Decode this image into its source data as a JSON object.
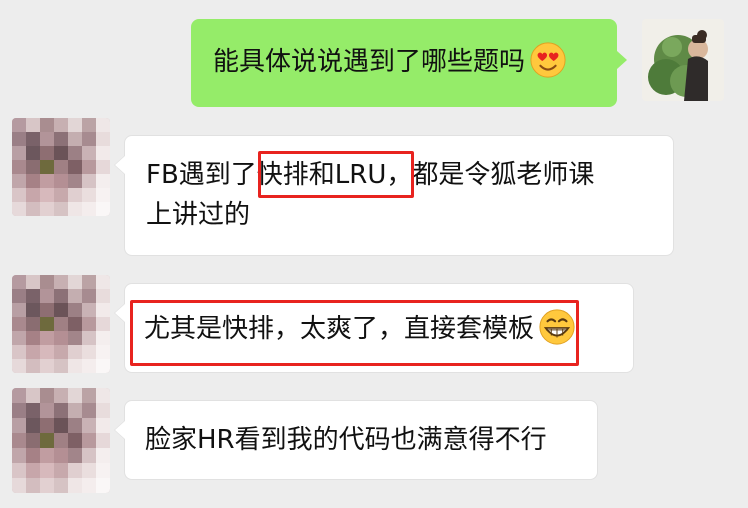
{
  "messages": [
    {
      "side": "outgoing",
      "text": "能具体说说遇到了哪些题吗",
      "emoji": "heart-eyes-emoji"
    },
    {
      "side": "incoming",
      "text_pre": "FB遇到了",
      "text_highlight": "快排和LRU",
      "text_after_line1": "，都是令狐老师课",
      "text_line2": "上讲过的"
    },
    {
      "side": "incoming",
      "text": "尤其是快排，太爽了，直接套模板",
      "emoji": "grinning-emoji"
    },
    {
      "side": "incoming",
      "text": "脸家HR看到我的代码也满意得不行"
    }
  ],
  "colors": {
    "background": "#ededed",
    "outgoing_bubble": "#95ec69",
    "incoming_bubble": "#ffffff",
    "highlight_box": "#e8231f"
  }
}
